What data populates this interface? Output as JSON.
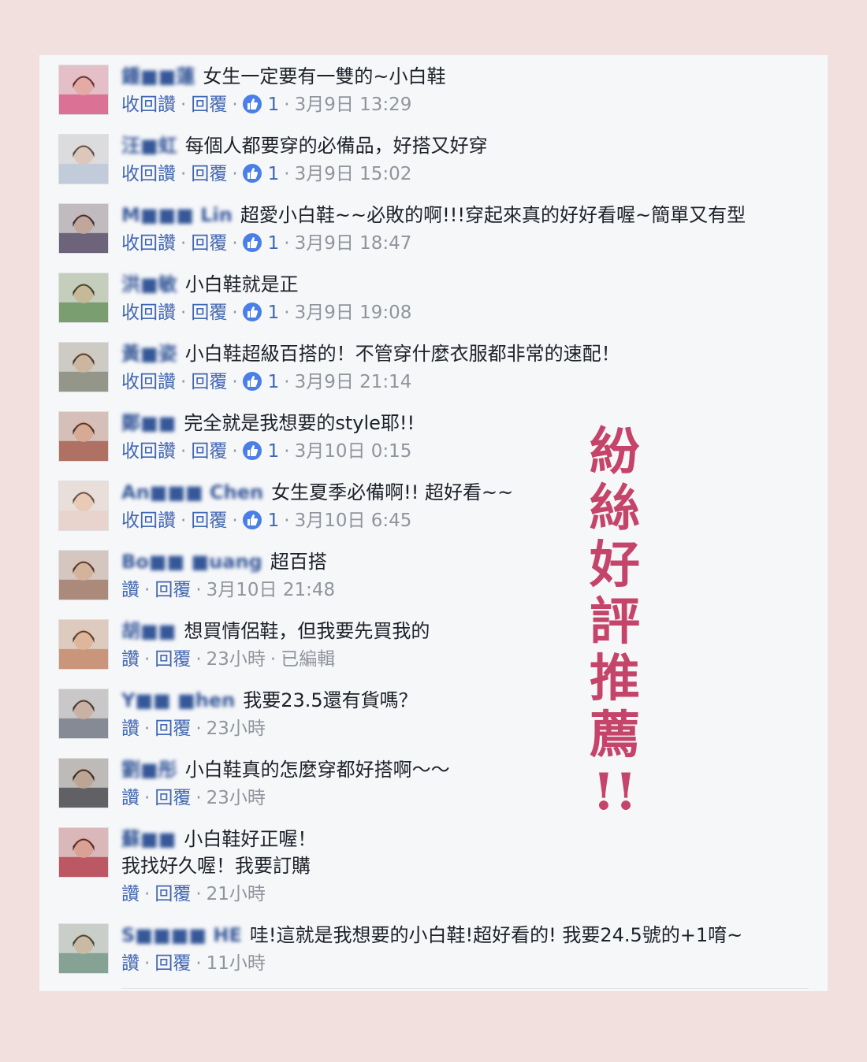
{
  "comments": [
    {
      "name": "鍾■■蓮",
      "text": "女生一定要有一雙的~小白鞋",
      "actions": [
        "收回讚",
        "回覆"
      ],
      "likes": "1",
      "time": "3月9日 13:29",
      "avatar": "#d85080"
    },
    {
      "name": "汪■虹",
      "text": "每個人都要穿的必備品，好搭又好穿",
      "actions": [
        "收回讚",
        "回覆"
      ],
      "likes": "1",
      "time": "3月9日 15:02",
      "avatar": "#b8c4d8"
    },
    {
      "name": "M■■■ Lin",
      "text": "超愛小白鞋~~必敗的啊!!!穿起來真的好好看喔~簡單又有型",
      "actions": [
        "收回讚",
        "回覆"
      ],
      "likes": "1",
      "time": "3月9日 18:47",
      "avatar": "#4a4060"
    },
    {
      "name": "洪■敏",
      "text": "小白鞋就是正",
      "actions": [
        "收回讚",
        "回覆"
      ],
      "likes": "1",
      "time": "3月9日 19:08",
      "avatar": "#5a8a50"
    },
    {
      "name": "黃■姿",
      "text": "小白鞋超級百搭的！不管穿什麼衣服都非常的速配！",
      "actions": [
        "收回讚",
        "回覆"
      ],
      "likes": "1",
      "time": "3月9日 21:14",
      "avatar": "#7a8070"
    },
    {
      "name": "鄭■■",
      "text": "完全就是我想要的style耶!!",
      "actions": [
        "收回讚",
        "回覆"
      ],
      "likes": "1",
      "time": "3月10日 0:15",
      "avatar": "#a05040"
    },
    {
      "name": "An■■■ Chen",
      "text": "女生夏季必備啊!! 超好看~~",
      "actions": [
        "收回讚",
        "回覆"
      ],
      "likes": "1",
      "time": "3月10日 6:45",
      "avatar": "#e8d0c8"
    },
    {
      "name": "Bo■■ ■uang",
      "text": "超百搭",
      "actions": [
        "讚",
        "回覆"
      ],
      "likes": "",
      "time": "3月10日 21:48",
      "avatar": "#9a7060"
    },
    {
      "name": "胡■■",
      "text": "想買情侶鞋，但我要先買我的",
      "actions": [
        "讚",
        "回覆"
      ],
      "likes": "",
      "time": "23小時",
      "edited": "已編輯",
      "avatar": "#c08060"
    },
    {
      "name": "Y■■ ■hen",
      "text": "我要23.5還有貨嗎？",
      "actions": [
        "讚",
        "回覆"
      ],
      "likes": "",
      "time": "23小時",
      "avatar": "#6a7080"
    },
    {
      "name": "劉■彤",
      "text": "小白鞋真的怎麼穿都好搭啊～～",
      "actions": [
        "讚",
        "回覆"
      ],
      "likes": "",
      "time": "23小時",
      "avatar": "#3a3a40"
    },
    {
      "name": "蘇■■",
      "text": "小白鞋好正喔！",
      "text2": "我找好久喔！我要訂購",
      "actions": [
        "讚",
        "回覆"
      ],
      "likes": "",
      "time": "21小時",
      "avatar": "#b03040"
    },
    {
      "name": "S■■■■ HE",
      "text": "哇!這就是我想要的小白鞋!超好看的! 我要24.5號的+1唷~",
      "actions": [
        "讚",
        "回覆"
      ],
      "likes": "",
      "time": "11小時",
      "avatar": "#6a9080"
    }
  ],
  "overlay": {
    "chars": [
      "紛",
      "絲",
      "好",
      "評",
      "推",
      "薦",
      "!!"
    ]
  },
  "colors": {
    "accent": "#4267b2",
    "name": "#365899",
    "overlay_text": "#c54469",
    "background": "#f1e0de",
    "panel": "#f6f7f9"
  }
}
